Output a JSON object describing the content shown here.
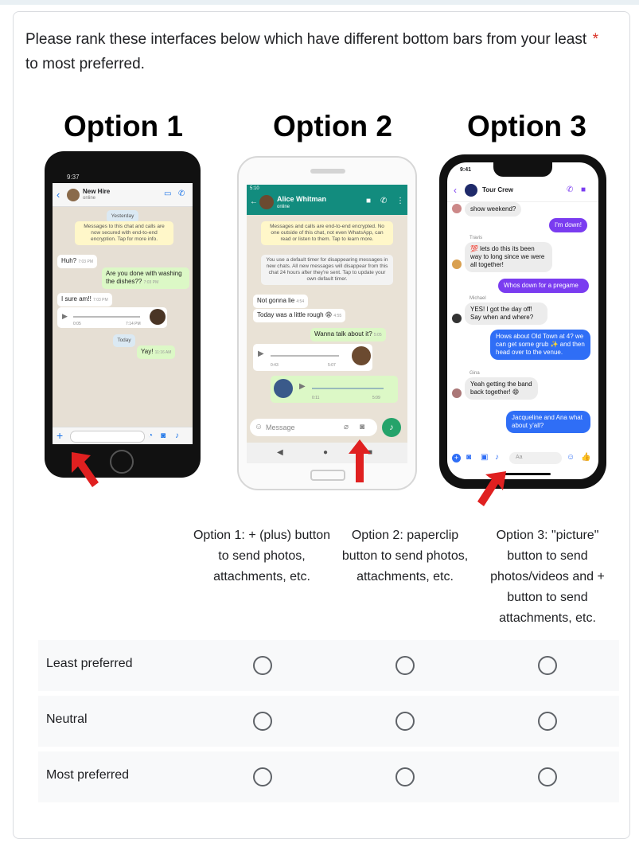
{
  "question": {
    "text": "Please rank these interfaces below which have different bottom bars from your least to most preferred.",
    "required_mark": "*"
  },
  "options": [
    {
      "title": "Option 1"
    },
    {
      "title": "Option 2"
    },
    {
      "title": "Option 3"
    }
  ],
  "phone1": {
    "time": "9:37",
    "contact": "New Hire",
    "presence": "online",
    "date1": "Yesterday",
    "encryption": "Messages to this chat and calls are now secured with end-to-end encryption. Tap for more info.",
    "m1": "Huh?",
    "m1_time": "7:03 PM",
    "m2": "Are you done with washing the dishes??",
    "m2_time": "7:03 PM",
    "m3": "I sure am!!",
    "m3_time": "7:03 PM",
    "voice_dur": "0:05",
    "voice_time": "7:14 PM",
    "date2": "Today",
    "m4": "Yay!",
    "m4_time": "11:16 AM"
  },
  "phone2": {
    "time": "5:10",
    "contact": "Alice Whitman",
    "presence": "online",
    "sys1": "Messages and calls are end-to-end encrypted. No one outside of this chat, not even WhatsApp, can read or listen to them. Tap to learn more.",
    "sys2": "You use a default timer for disappearing messages in new chats. All new messages will disappear from this chat 24 hours after they're sent. Tap to update your own default timer.",
    "m1": "Not gonna lie",
    "m1_time": "4:54",
    "m2": "Today was a little rough 😩",
    "m2_time": "4:55",
    "m3": "Wanna talk about it?",
    "m3_time": "5:05",
    "v1_pos": "0:43",
    "v1_time": "5:07",
    "v2_pos": "0:11",
    "v2_time": "5:09",
    "input_placeholder": "Message"
  },
  "phone3": {
    "time": "9:41",
    "group": "Tour Crew",
    "m0": "show weekend?",
    "m1": "I'm down!",
    "s1": "Travis",
    "m2": "💯 lets do this its been way to long since we were all together!",
    "m3": "Whos down for a pregame",
    "s2": "Michael",
    "m4": "YES! I got the day off! Say when and where?",
    "m5": "Hows about Old Town at 4? we can get some grub ✨ and then head over to the venue.",
    "s3": "Gina",
    "m6": "Yeah getting the band back together! 😄",
    "m7": "Jacqueline and Ana what about y'all?",
    "input_placeholder": "Aa"
  },
  "grid": {
    "columns": [
      "Option 1: + (plus) button to send photos, attachments, etc.",
      "Option 2: paperclip button to send photos, attachments, etc.",
      "Option 3: \"picture\" button to send photos/videos and + button to send attachments, etc."
    ],
    "rows": [
      "Least preferred",
      "Neutral",
      "Most preferred"
    ]
  },
  "colors": {
    "accent_red": "#d93025",
    "arrow_red": "#e02020",
    "whatsapp_green": "#128c7e",
    "messenger_purple": "#7a3cf0",
    "messenger_blue": "#2f6ef6"
  }
}
